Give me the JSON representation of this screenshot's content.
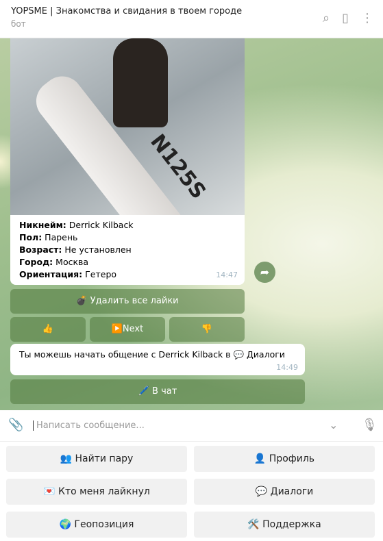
{
  "header": {
    "title": "YOPSME | Знакомства и свидания в твоем городе",
    "subtitle": "бот",
    "icons": [
      "search-icon",
      "sidebar-icon",
      "more-icon"
    ]
  },
  "profile": {
    "image_text": "N125S",
    "fields": [
      {
        "label": "Никнейм:",
        "value": " Derrick Kilback"
      },
      {
        "label": "Пол:",
        "value": " Парень"
      },
      {
        "label": "Возраст:",
        "value": " Не установлен"
      },
      {
        "label": "Город:",
        "value": " Москва"
      },
      {
        "label": "Ориентация:",
        "value": " Гетеро"
      }
    ],
    "time": "14:47"
  },
  "inline": {
    "delete_likes": "💣 Удалить все лайки",
    "like": "👍",
    "next": "▶️Next",
    "dislike": "👎"
  },
  "message": {
    "text": "Ты можешь начать общение с Derrick Kilback в 💬 Диалоги",
    "time": "14:49",
    "button": "🖊️ В чат"
  },
  "input": {
    "placeholder": "Написать сообщение..."
  },
  "keyboard": [
    "👥 Найти пару",
    "👤 Профиль",
    "💌 Кто меня лайкнул",
    "💬 Диалоги",
    "🌍 Геопозиция",
    "🛠️ Поддержка"
  ]
}
